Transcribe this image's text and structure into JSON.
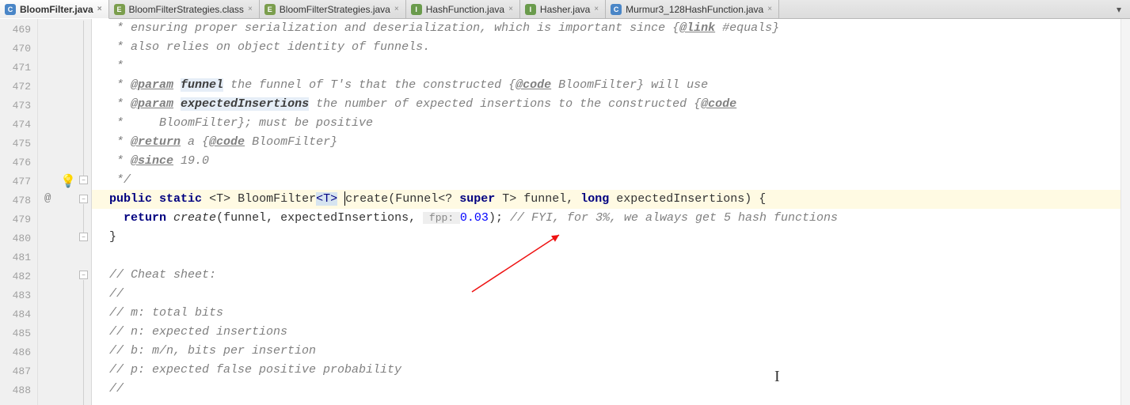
{
  "tabs": [
    {
      "label": "BloomFilter.java",
      "icon": "C",
      "iconClass": "ic-c",
      "active": true
    },
    {
      "label": "BloomFilterStrategies.class",
      "icon": "E",
      "iconClass": "ic-e",
      "active": false
    },
    {
      "label": "BloomFilterStrategies.java",
      "icon": "E",
      "iconClass": "ic-e",
      "active": false
    },
    {
      "label": "HashFunction.java",
      "icon": "I",
      "iconClass": "ic-i",
      "active": false
    },
    {
      "label": "Hasher.java",
      "icon": "I",
      "iconClass": "ic-i",
      "active": false
    },
    {
      "label": "Murmur3_128HashFunction.java",
      "icon": "C",
      "iconClass": "ic-c",
      "active": false
    }
  ],
  "lineNumbers": [
    "469",
    "470",
    "471",
    "472",
    "473",
    "474",
    "475",
    "476",
    "477",
    "478",
    "479",
    "480",
    "481",
    "482",
    "483",
    "484",
    "485",
    "486",
    "487",
    "488"
  ],
  "code": {
    "l469": {
      "prefix": "   * ensuring proper serialization and deserialization, which is important since {",
      "tag": "@link",
      "suffix": " #equals}"
    },
    "l470": "   * also relies on object identity of funnels.",
    "l471": "   *",
    "l472": {
      "prefix": "   * ",
      "tag": "@param",
      "param": "funnel",
      "rest": " the funnel of T's that the constructed {",
      "tag2": "@code",
      "rest2": " BloomFilter} will use"
    },
    "l473": {
      "prefix": "   * ",
      "tag": "@param",
      "param": "expectedInsertions",
      "rest": " the number of expected insertions to the constructed {",
      "tag2": "@code"
    },
    "l474": "   *     BloomFilter}; must be positive",
    "l475": {
      "prefix": "   * ",
      "tag": "@return",
      "rest": " a {",
      "tag2": "@code",
      "rest2": " BloomFilter}"
    },
    "l476": {
      "prefix": "   * ",
      "tag": "@since",
      "rest": " 19.0"
    },
    "l477": "   */",
    "l478": {
      "kw1": "public",
      "kw2": "static",
      "gen1": "<T>",
      "type": "BloomFilter",
      "genhl": "<T>",
      "method": "create",
      "sig1": "(Funnel<? ",
      "kw3": "super",
      "sig2": " T> funnel, ",
      "kw4": "long",
      "sig3": " expectedInsertions) {"
    },
    "l479": {
      "kw": "return",
      "method": "create",
      "args1": "(funnel, expectedInsertions, ",
      "hint": " fpp: ",
      "num": "0.03",
      "args2": "); ",
      "comment": "// FYI, for 3%, we always get 5 hash functions"
    },
    "l480": "  }",
    "l482": "  // Cheat sheet:",
    "l483": "  //",
    "l484": "  // m: total bits",
    "l485": "  // n: expected insertions",
    "l486": "  // b: m/n, bits per insertion",
    "l487": "  // p: expected false positive probability",
    "l488": "  //"
  },
  "markers": {
    "atSymbol": "@",
    "close": "×",
    "dropdown": "▾",
    "foldMinus": "−"
  }
}
